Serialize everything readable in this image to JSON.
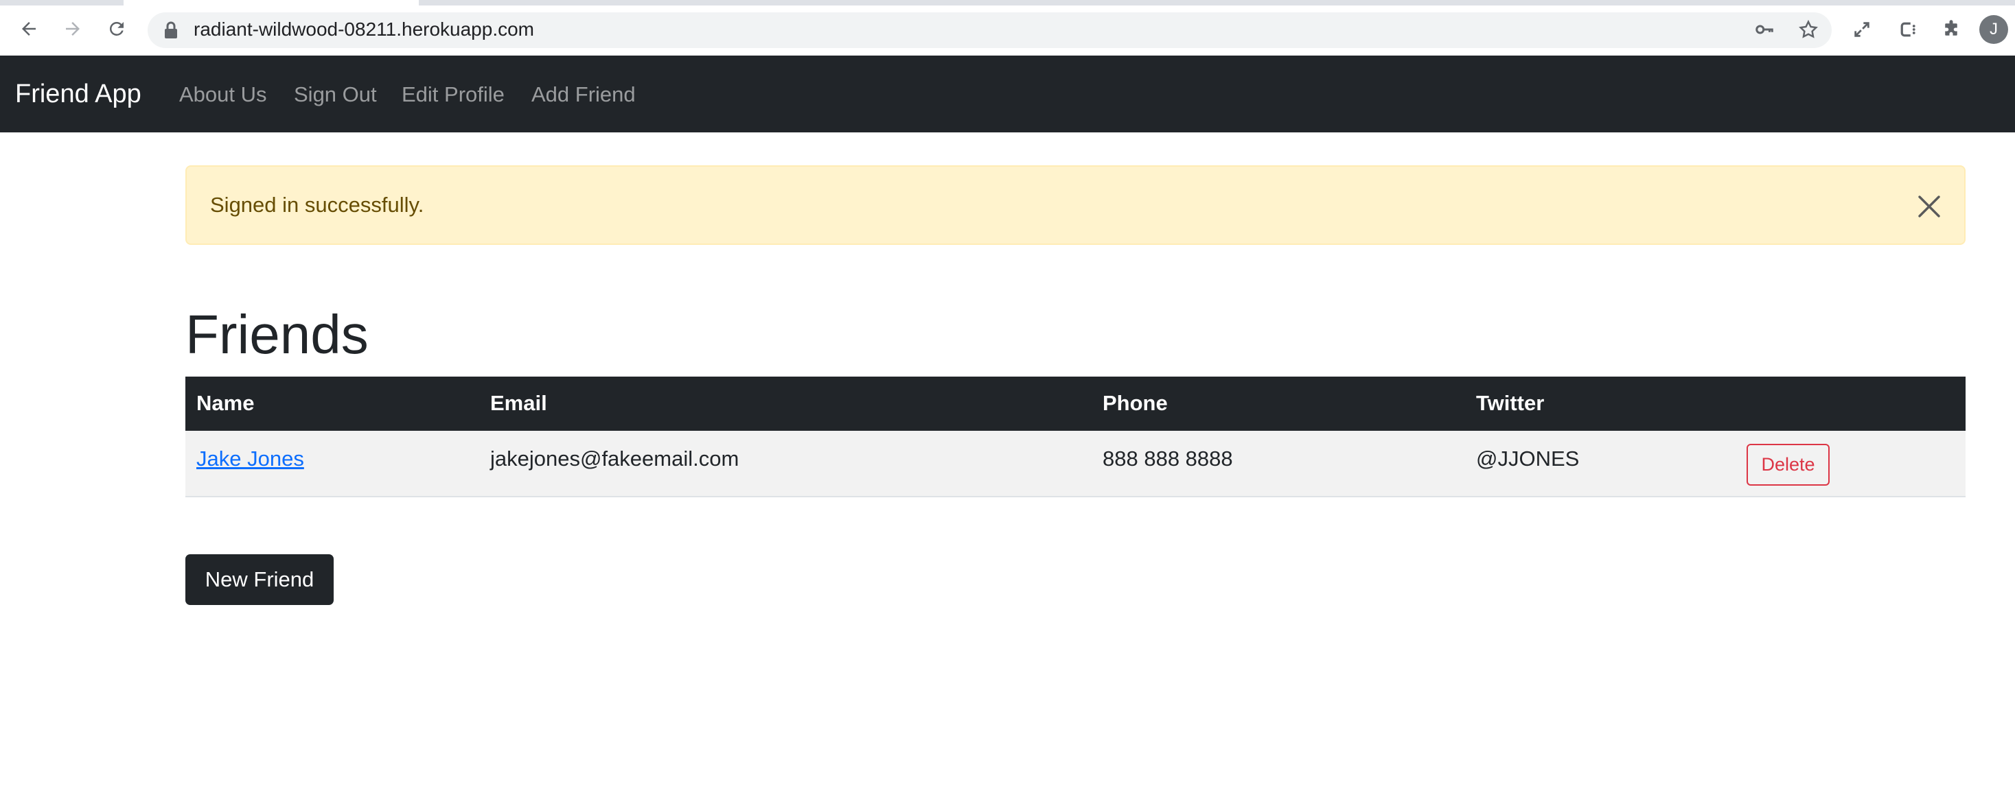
{
  "browser": {
    "url": "radiant-wildwood-08211.herokuapp.com",
    "profile_initial": "J",
    "icons": [
      "back-icon",
      "forward-icon",
      "reload-icon",
      "lock-icon",
      "key-icon",
      "star-icon",
      "fullscreen-icon",
      "extension-c-icon",
      "puzzle-icon"
    ]
  },
  "navbar": {
    "brand": "Friend App",
    "links": [
      "About Us",
      "Sign Out",
      "Edit Profile",
      "Add Friend"
    ]
  },
  "alert": {
    "message": "Signed in successfully.",
    "close_icon": "close-icon"
  },
  "page": {
    "title": "Friends"
  },
  "table": {
    "headers": [
      "Name",
      "Email",
      "Phone",
      "Twitter"
    ],
    "rows": [
      {
        "name": "Jake Jones",
        "email": "jakejones@fakeemail.com",
        "phone": "888 888 8888",
        "twitter": "@JJONES",
        "action": "Delete"
      }
    ]
  },
  "actions": {
    "new_friend": "New Friend"
  },
  "colors": {
    "navbar": "#212529",
    "alert_bg": "#fff3cd",
    "alert_text": "#664d03",
    "link": "#0d6efd",
    "danger": "#dc3545"
  }
}
